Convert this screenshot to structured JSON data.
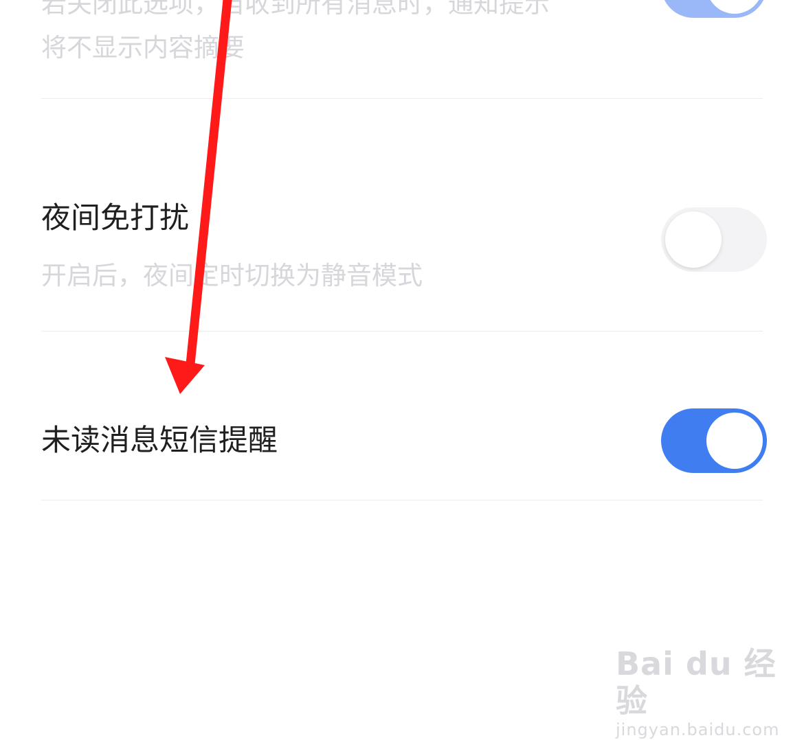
{
  "settings": {
    "top_item": {
      "desc_line1": "若关闭此选项，当收到所有消息时，通知提示",
      "desc_line2": "将不显示内容摘要",
      "enabled": true
    },
    "night_dnd": {
      "title": "夜间免打扰",
      "desc": "开启后，夜间定时切换为静音模式",
      "enabled": false
    },
    "unread_sms": {
      "title": "未读消息短信提醒",
      "enabled": true
    }
  },
  "colors": {
    "toggle_on": "#3f7df0",
    "toggle_off": "#f3f3f5",
    "annotation_arrow": "#ff1a1a"
  },
  "watermark": {
    "brand": "Bai du 经验",
    "url": "jingyan.baidu.com"
  }
}
